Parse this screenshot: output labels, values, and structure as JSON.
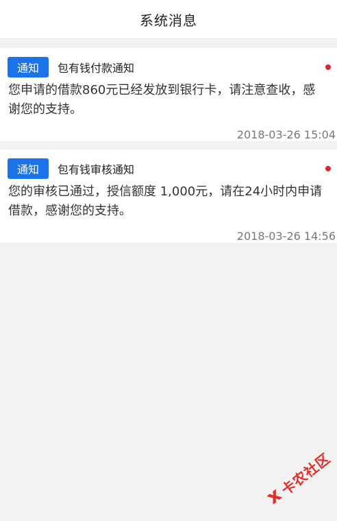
{
  "header": {
    "title": "系统消息"
  },
  "messages": [
    {
      "badge": "通知",
      "title": "包有钱付款通知",
      "body": "您申请的借款860元已经发放到银行卡，请注意查收，感谢您的支持。",
      "time": "2018-03-26 15:04",
      "unread": true
    },
    {
      "badge": "通知",
      "title": "包有钱审核通知",
      "body": "您的审核已通过，授信额度 1,000元，请在24小时内申请借款，感谢您的支持。",
      "time": "2018-03-26 14:56",
      "unread": true
    }
  ],
  "watermark": {
    "text": "卡农社区"
  },
  "colors": {
    "badge_bg": "#1a73e8",
    "unread_dot": "#e0262d",
    "background": "#f2f2f2",
    "watermark": "#e0302a"
  }
}
